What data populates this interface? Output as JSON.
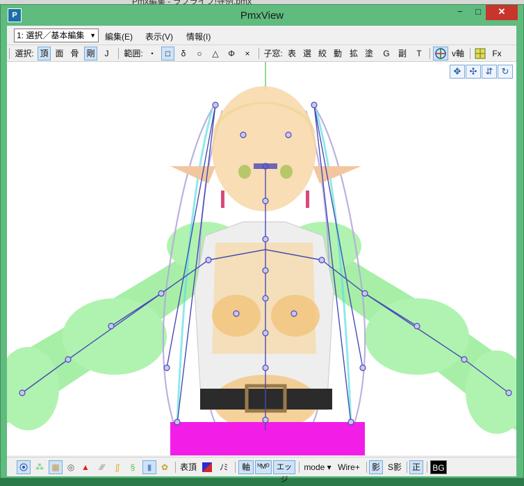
{
  "background_window": {
    "title_fragment": "Pmx編集 - ラブライブ!寺例.pmx"
  },
  "window": {
    "title": "PmxView",
    "min_label": "−",
    "max_label": "□",
    "close_label": "✕",
    "icon_label": "P"
  },
  "menubar": {
    "mode_select": "1: 選択／基本編集",
    "items": [
      "編集(E)",
      "表示(V)",
      "情報(I)"
    ]
  },
  "toolbar": {
    "select_label": "選択:",
    "select_items": [
      "頂",
      "面",
      "骨",
      "剛",
      "J"
    ],
    "range_label": "範囲:",
    "range_items": [
      "・",
      "□",
      "δ",
      "○",
      "△",
      "Φ",
      "×"
    ],
    "child_label": "子窓:",
    "child_items": [
      "表",
      "選",
      "絞",
      "動",
      "拡",
      "塗",
      "G",
      "副",
      "T"
    ],
    "axis_label": "v軸",
    "fx_label": "Fx"
  },
  "viewport": {
    "nav_buttons": [
      "move-arrows-icon",
      "pan-arrows-icon",
      "zoom-icon",
      "rotate-icon"
    ]
  },
  "statusbar": {
    "items": [
      "表頂",
      "ﾉﾐ",
      "軸",
      "ᴺMᴰ",
      "エッジ",
      "mode ▾",
      "Wire+",
      "影",
      "S影",
      "正",
      "BG"
    ]
  },
  "colors": {
    "window_frame": "#5fbb7e",
    "close_button": "#c7352d",
    "toggle_on": "#cde3f7",
    "skirt": "#f21ee8",
    "skin": "#f6d9a8",
    "bone_line": "#4a4ab5",
    "rigid_green": "#6ee66e"
  }
}
